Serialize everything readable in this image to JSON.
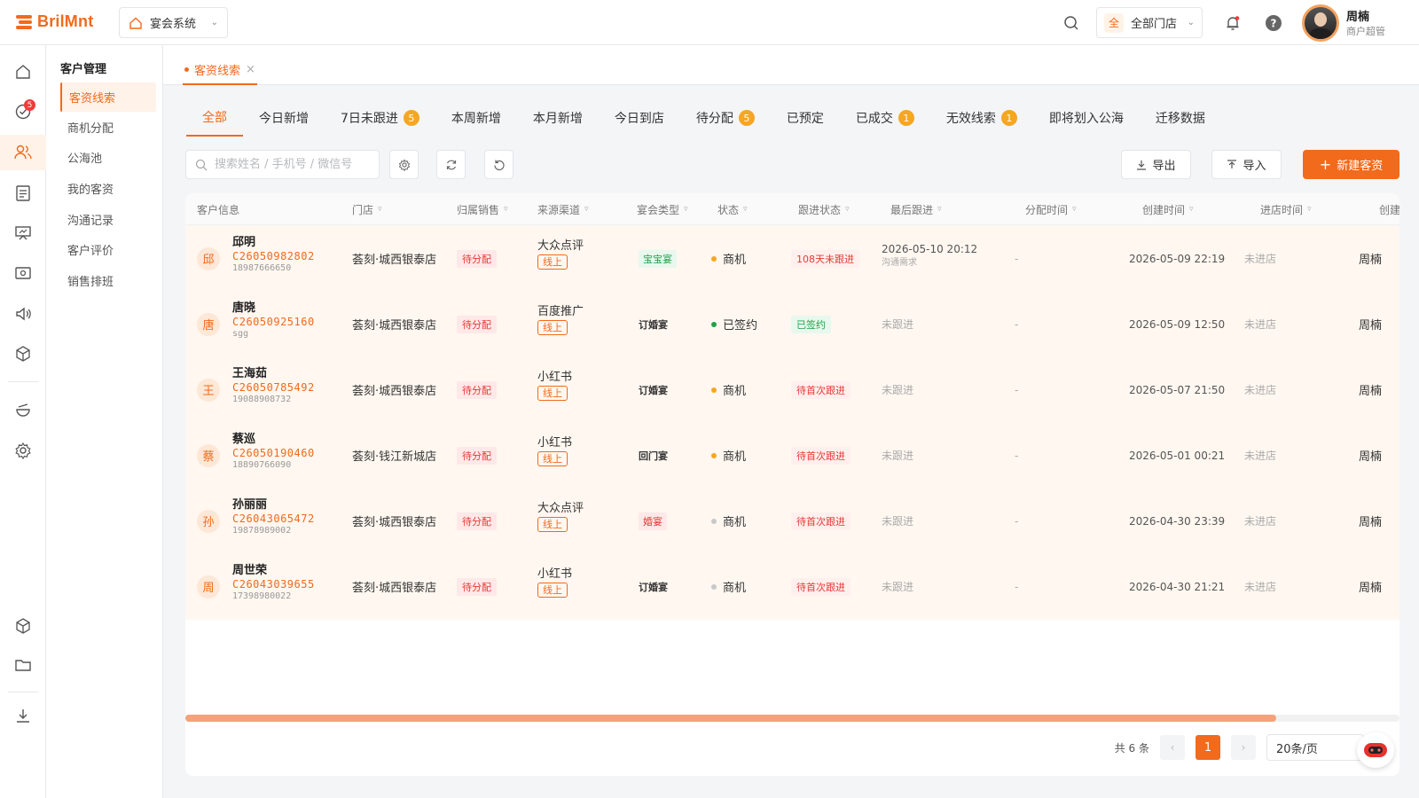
{
  "app": {
    "logo_text": "BrilMnt",
    "system_select": "宴会系统"
  },
  "header": {
    "store_select_badge": "全",
    "store_select": "全部门店",
    "user_name": "周楠",
    "user_role": "商户超管"
  },
  "iconbar": {
    "notification_badge": "5"
  },
  "subnav": {
    "title": "客户管理",
    "items": [
      "客资线索",
      "商机分配",
      "公海池",
      "我的客资",
      "沟通记录",
      "客户评价",
      "销售排班"
    ]
  },
  "page_tab": {
    "label": "客资线索"
  },
  "filter_tabs": [
    {
      "label": "全部",
      "count": ""
    },
    {
      "label": "今日新增",
      "count": ""
    },
    {
      "label": "7日未跟进",
      "count": "5"
    },
    {
      "label": "本周新增",
      "count": ""
    },
    {
      "label": "本月新增",
      "count": ""
    },
    {
      "label": "今日到店",
      "count": ""
    },
    {
      "label": "待分配",
      "count": "5"
    },
    {
      "label": "已预定",
      "count": ""
    },
    {
      "label": "已成交",
      "count": "1"
    },
    {
      "label": "无效线索",
      "count": "1"
    },
    {
      "label": "即将划入公海",
      "count": ""
    },
    {
      "label": "迁移数据",
      "count": ""
    }
  ],
  "toolbar": {
    "search_placeholder": "搜索姓名 / 手机号 / 微信号",
    "export": "导出",
    "import": "导入",
    "new": "新建客资"
  },
  "table": {
    "headers": [
      "客户信息",
      "门店",
      "归属销售",
      "来源渠道",
      "宴会类型",
      "状态",
      "跟进状态",
      "最后跟进",
      "分配时间",
      "创建时间",
      "进店时间",
      "创建"
    ],
    "rows": [
      {
        "surname": "邱",
        "name": "邱明",
        "code": "C26050982802",
        "phone": "18987666650",
        "store": "荟刻·城西银泰店",
        "sales": "待分配",
        "source": "大众点评",
        "source_tag": "线上",
        "type": "宝宝宴",
        "type_style": "green",
        "status": "商机",
        "status_color": "#f5a623",
        "follow": "108天未跟进",
        "follow_style": "red",
        "last_follow": "2026-05-10 20:12",
        "last_follow_sub": "沟通需求",
        "assign_time": "-",
        "create_time": "2026-05-09 22:19",
        "visit_time": "未进店",
        "creator": "周楠"
      },
      {
        "surname": "唐",
        "name": "唐晓",
        "code": "C26050925160",
        "phone": "sgg",
        "store": "荟刻·城西银泰店",
        "sales": "待分配",
        "source": "百度推广",
        "source_tag": "线上",
        "type": "订婚宴",
        "type_style": "plain",
        "status": "已签约",
        "status_color": "#22a04a",
        "follow": "已签约",
        "follow_style": "green",
        "last_follow": "未跟进",
        "last_follow_sub": "",
        "assign_time": "-",
        "create_time": "2026-05-09 12:50",
        "visit_time": "未进店",
        "creator": "周楠"
      },
      {
        "surname": "王",
        "name": "王海茹",
        "code": "C26050785492",
        "phone": "19088908732",
        "store": "荟刻·城西银泰店",
        "sales": "待分配",
        "source": "小红书",
        "source_tag": "线上",
        "type": "订婚宴",
        "type_style": "plain",
        "status": "商机",
        "status_color": "#f5a623",
        "follow": "待首次跟进",
        "follow_style": "red",
        "last_follow": "未跟进",
        "last_follow_sub": "",
        "assign_time": "-",
        "create_time": "2026-05-07 21:50",
        "visit_time": "未进店",
        "creator": "周楠"
      },
      {
        "surname": "蔡",
        "name": "蔡巡",
        "code": "C26050190460",
        "phone": "18890766090",
        "store": "荟刻·钱江新城店",
        "sales": "待分配",
        "source": "小红书",
        "source_tag": "线上",
        "type": "回门宴",
        "type_style": "plain",
        "status": "商机",
        "status_color": "#f5a623",
        "follow": "待首次跟进",
        "follow_style": "red",
        "last_follow": "未跟进",
        "last_follow_sub": "",
        "assign_time": "-",
        "create_time": "2026-05-01 00:21",
        "visit_time": "未进店",
        "creator": "周楠"
      },
      {
        "surname": "孙",
        "name": "孙丽丽",
        "code": "C26043065472",
        "phone": "19878989002",
        "store": "荟刻·城西银泰店",
        "sales": "待分配",
        "source": "大众点评",
        "source_tag": "线上",
        "type": "婚宴",
        "type_style": "red",
        "status": "商机",
        "status_color": "#c8c8c8",
        "follow": "待首次跟进",
        "follow_style": "red",
        "last_follow": "未跟进",
        "last_follow_sub": "",
        "assign_time": "-",
        "create_time": "2026-04-30 23:39",
        "visit_time": "未进店",
        "creator": "周楠"
      },
      {
        "surname": "周",
        "name": "周世荣",
        "code": "C26043039655",
        "phone": "17398980022",
        "store": "荟刻·城西银泰店",
        "sales": "待分配",
        "source": "小红书",
        "source_tag": "线上",
        "type": "订婚宴",
        "type_style": "plain",
        "status": "商机",
        "status_color": "#c8c8c8",
        "follow": "待首次跟进",
        "follow_style": "red",
        "last_follow": "未跟进",
        "last_follow_sub": "",
        "assign_time": "-",
        "create_time": "2026-04-30 21:21",
        "visit_time": "未进店",
        "creator": "周楠"
      }
    ]
  },
  "pagination": {
    "total": "共 6 条",
    "current": "1",
    "page_size": "20条/页"
  },
  "colors": {
    "accent": "#f26a1b",
    "warning": "#f5a623",
    "danger": "#e53935",
    "success": "#22a04a"
  }
}
